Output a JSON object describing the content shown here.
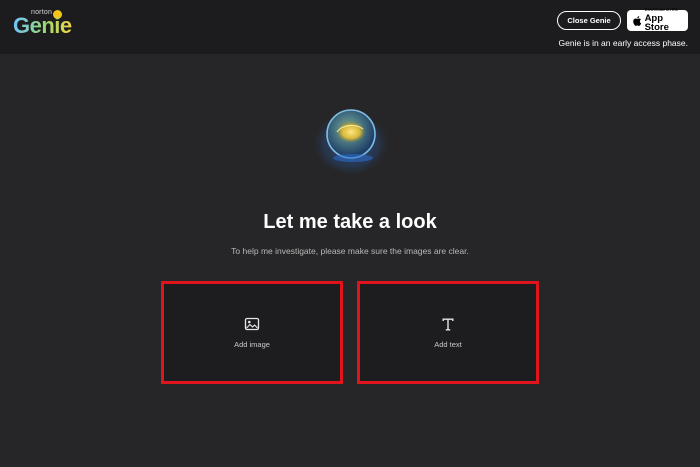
{
  "header": {
    "logo_small": "norton",
    "logo_main": "Genie",
    "close_label": "Close Genie",
    "appstore_small": "Download on the",
    "appstore_big": "App Store",
    "notice": "Genie is in an early access phase."
  },
  "main": {
    "title": "Let me take a look",
    "subtitle": "To help me investigate, please make sure the images are clear."
  },
  "options": {
    "image_label": "Add image",
    "text_label": "Add text"
  },
  "icons": {
    "logo": "norton-genie-logo",
    "apple": "apple-icon",
    "orb": "genie-orb",
    "image": "image-icon",
    "text": "text-t-icon"
  },
  "colors": {
    "background": "#262628",
    "topbar": "#1c1c1e",
    "card_border": "#e0141c"
  }
}
